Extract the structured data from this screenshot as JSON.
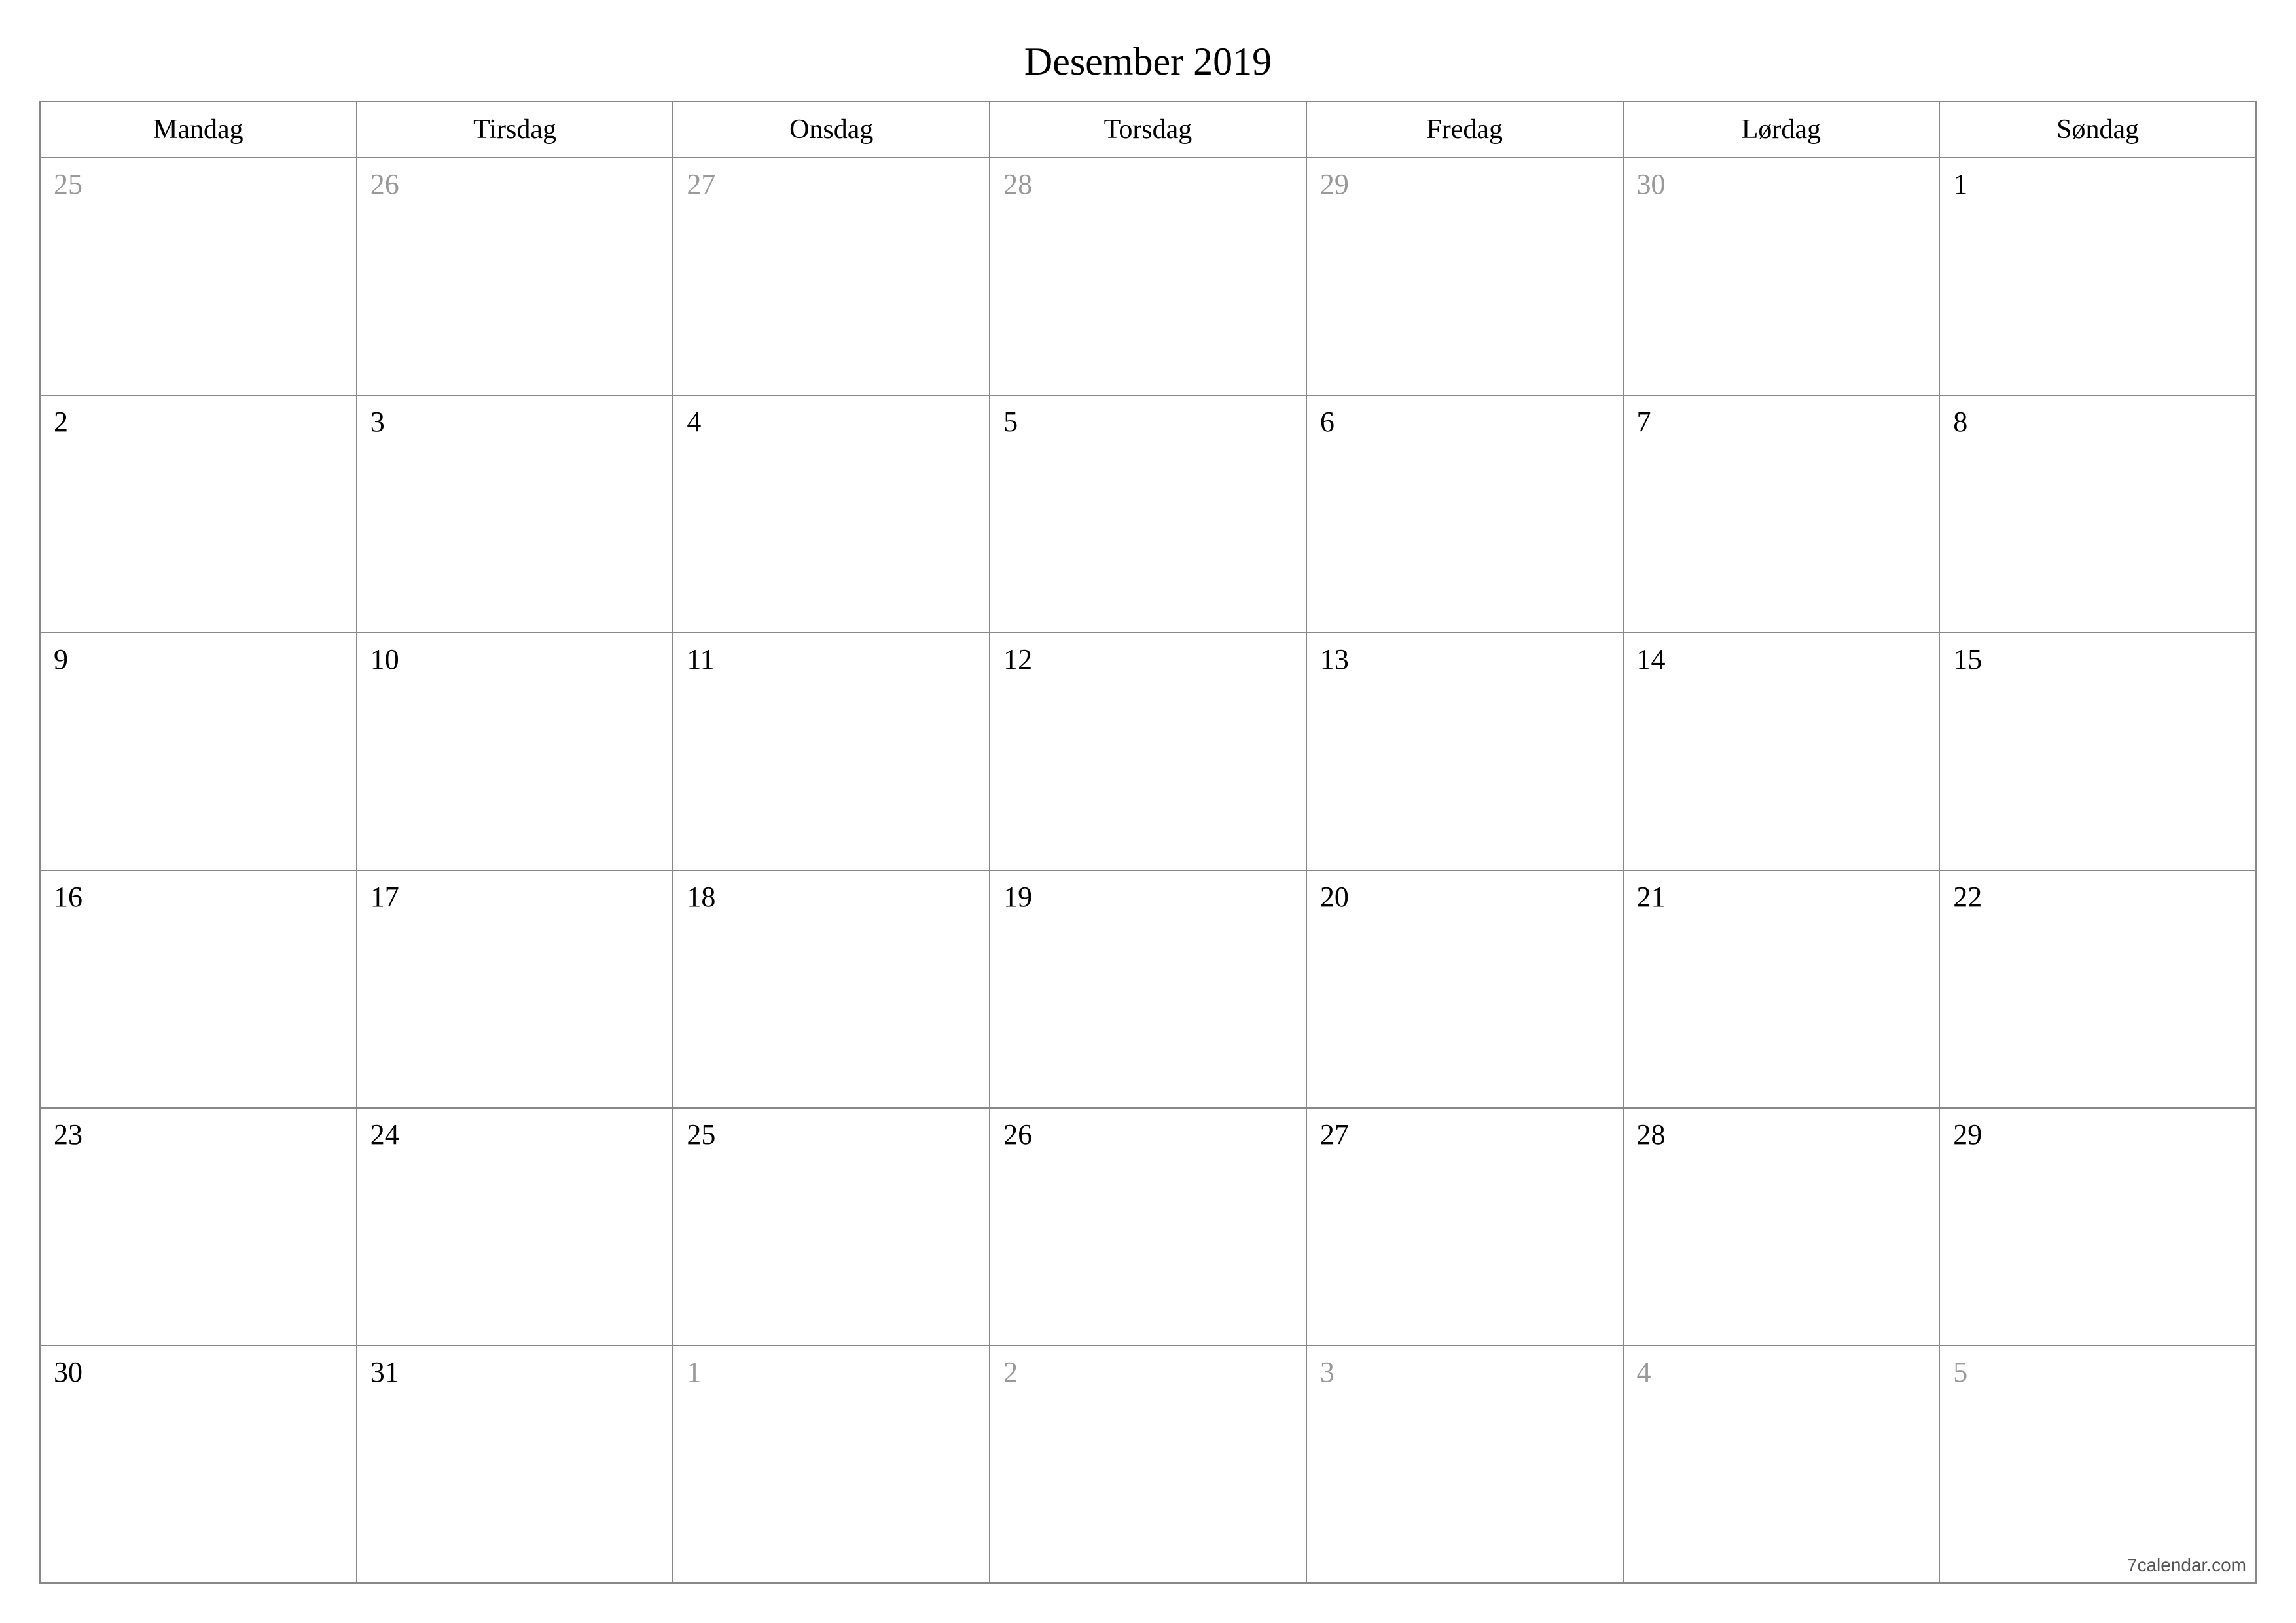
{
  "title": "Desember 2019",
  "weekdays": [
    "Mandag",
    "Tirsdag",
    "Onsdag",
    "Torsdag",
    "Fredag",
    "Lørdag",
    "Søndag"
  ],
  "weeks": [
    [
      {
        "day": "25",
        "other": true
      },
      {
        "day": "26",
        "other": true
      },
      {
        "day": "27",
        "other": true
      },
      {
        "day": "28",
        "other": true
      },
      {
        "day": "29",
        "other": true
      },
      {
        "day": "30",
        "other": true
      },
      {
        "day": "1",
        "other": false
      }
    ],
    [
      {
        "day": "2",
        "other": false
      },
      {
        "day": "3",
        "other": false
      },
      {
        "day": "4",
        "other": false
      },
      {
        "day": "5",
        "other": false
      },
      {
        "day": "6",
        "other": false
      },
      {
        "day": "7",
        "other": false
      },
      {
        "day": "8",
        "other": false
      }
    ],
    [
      {
        "day": "9",
        "other": false
      },
      {
        "day": "10",
        "other": false
      },
      {
        "day": "11",
        "other": false
      },
      {
        "day": "12",
        "other": false
      },
      {
        "day": "13",
        "other": false
      },
      {
        "day": "14",
        "other": false
      },
      {
        "day": "15",
        "other": false
      }
    ],
    [
      {
        "day": "16",
        "other": false
      },
      {
        "day": "17",
        "other": false
      },
      {
        "day": "18",
        "other": false
      },
      {
        "day": "19",
        "other": false
      },
      {
        "day": "20",
        "other": false
      },
      {
        "day": "21",
        "other": false
      },
      {
        "day": "22",
        "other": false
      }
    ],
    [
      {
        "day": "23",
        "other": false
      },
      {
        "day": "24",
        "other": false
      },
      {
        "day": "25",
        "other": false
      },
      {
        "day": "26",
        "other": false
      },
      {
        "day": "27",
        "other": false
      },
      {
        "day": "28",
        "other": false
      },
      {
        "day": "29",
        "other": false
      }
    ],
    [
      {
        "day": "30",
        "other": false
      },
      {
        "day": "31",
        "other": false
      },
      {
        "day": "1",
        "other": true
      },
      {
        "day": "2",
        "other": true
      },
      {
        "day": "3",
        "other": true
      },
      {
        "day": "4",
        "other": true
      },
      {
        "day": "5",
        "other": true
      }
    ]
  ],
  "footer": "7calendar.com"
}
